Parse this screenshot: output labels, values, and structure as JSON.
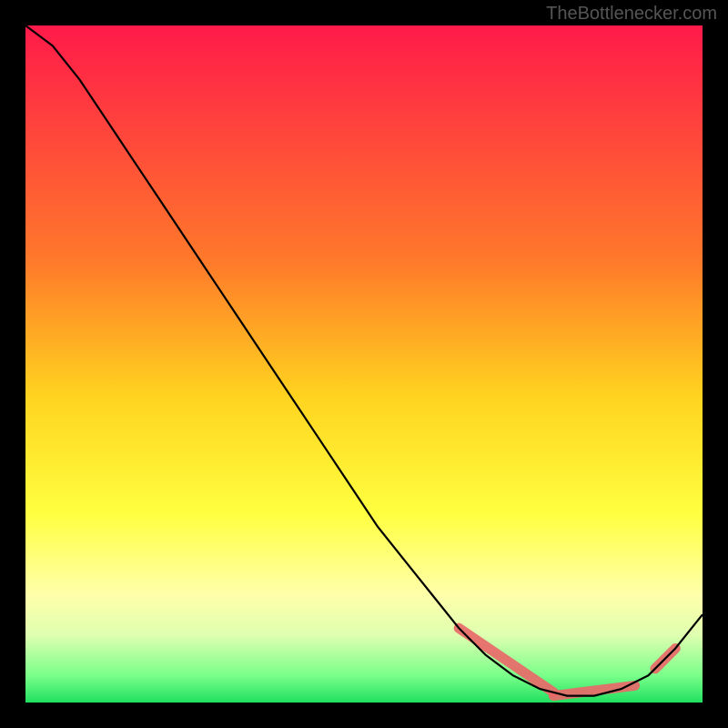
{
  "watermark": "TheBottlenecker.com",
  "chart_data": {
    "type": "line",
    "title": "",
    "xlabel": "",
    "ylabel": "",
    "xlim": [
      0,
      100
    ],
    "ylim": [
      0,
      100
    ],
    "series": [
      {
        "name": "curve",
        "x": [
          0,
          4,
          8,
          12,
          16,
          20,
          24,
          28,
          32,
          36,
          40,
          44,
          48,
          52,
          56,
          60,
          64,
          68,
          72,
          76,
          80,
          84,
          88,
          92,
          96,
          100
        ],
        "y": [
          100,
          97,
          92,
          86,
          80,
          74,
          68,
          62,
          56,
          50,
          44,
          38,
          32,
          26,
          21,
          16,
          11,
          7,
          4,
          2,
          1,
          1,
          2,
          4,
          8,
          13
        ]
      }
    ],
    "highlight_segments": [
      {
        "x": [
          64,
          78
        ],
        "y": [
          11,
          1.5
        ]
      },
      {
        "x": [
          78,
          90
        ],
        "y": [
          1,
          2.5
        ]
      },
      {
        "x": [
          93,
          96
        ],
        "y": [
          5,
          8
        ]
      }
    ],
    "gradient_stops": [
      {
        "offset": 0,
        "color": "#ff1a4a"
      },
      {
        "offset": 35,
        "color": "#ff7a2a"
      },
      {
        "offset": 55,
        "color": "#ffd41f"
      },
      {
        "offset": 72,
        "color": "#ffff40"
      },
      {
        "offset": 84,
        "color": "#ffffaa"
      },
      {
        "offset": 90,
        "color": "#dfffb0"
      },
      {
        "offset": 96,
        "color": "#7aff8a"
      },
      {
        "offset": 100,
        "color": "#20e060"
      }
    ],
    "highlight_color": "#e96a6a"
  }
}
